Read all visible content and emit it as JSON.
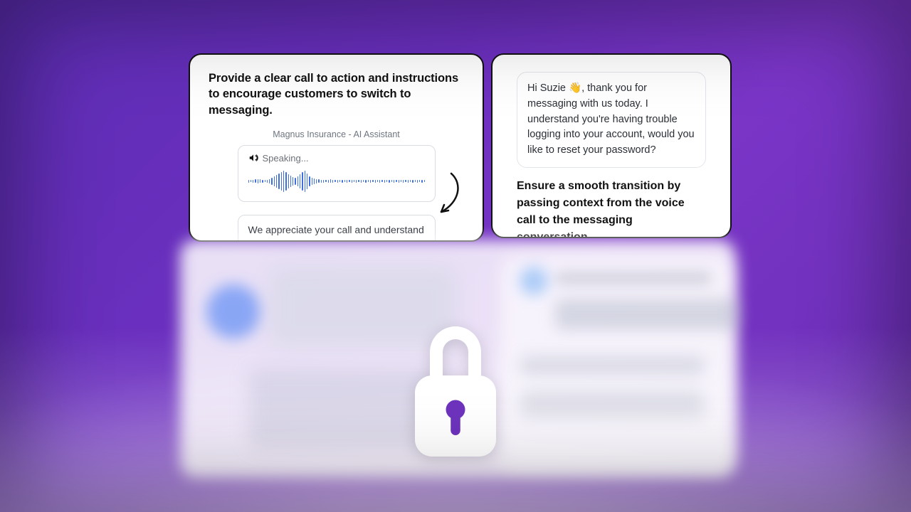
{
  "left": {
    "headline": "Provide a clear call to action and instructions to encourage customers to switch to messaging.",
    "assistant_label": "Magnus Insurance - AI Assistant",
    "speaking_label": "Speaking...",
    "transcript": "We appreciate your call and understand that waiting for someone to answer can be a hassle. Rest assured we have some"
  },
  "right": {
    "chat_prefix": "Hi Suzie ",
    "chat_suffix": ", thank you for messaging with us today. I understand you're having trouble logging into your account, would you like to reset your password?",
    "subhead": "Ensure a smooth transition by passing context from the voice call to the messaging conversation."
  },
  "icons": {
    "speaker": "speaker-icon",
    "wave_emoji": "👋",
    "lock": "lock-icon",
    "arrow": "arrow-icon"
  }
}
